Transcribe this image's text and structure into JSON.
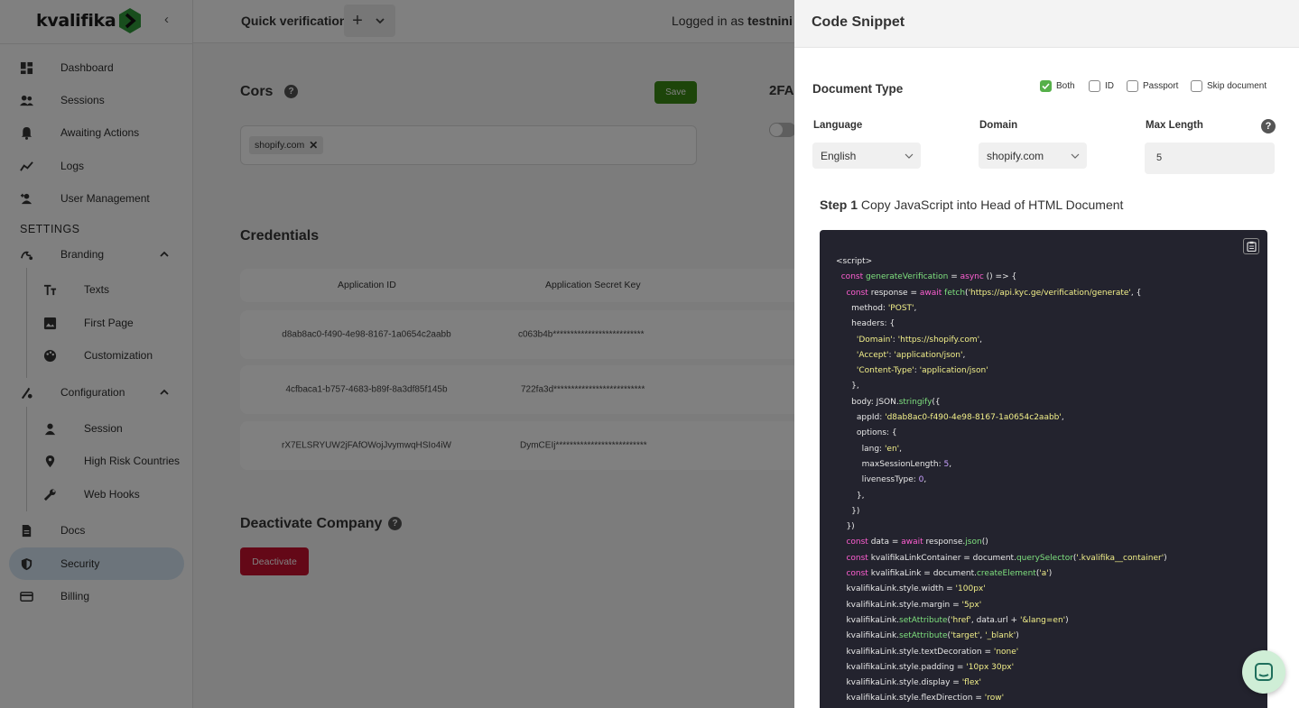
{
  "sidebar": {
    "logo_text": "kvalifika",
    "collapse_icon": "chevron-left-icon",
    "items": [
      {
        "label": "Dashboard",
        "icon": "dashboard-icon"
      },
      {
        "label": "Sessions",
        "icon": "people-icon"
      },
      {
        "label": "Awaiting Actions",
        "icon": "bell-icon"
      },
      {
        "label": "Logs",
        "icon": "trend-line-icon"
      },
      {
        "label": "User Management",
        "icon": "add-user-icon"
      }
    ],
    "settings_heading": "SETTINGS",
    "branding": {
      "label": "Branding",
      "icon": "brush-icon",
      "children": [
        {
          "label": "Texts",
          "icon": "text-size-icon"
        },
        {
          "label": "First Page",
          "icon": "image-icon"
        },
        {
          "label": "Customization",
          "icon": "palette-icon"
        }
      ]
    },
    "configuration": {
      "label": "Configuration",
      "icon": "config-icon",
      "children": [
        {
          "label": "Session",
          "icon": "person-icon"
        },
        {
          "label": "High Risk Countries",
          "icon": "location-pin-icon"
        },
        {
          "label": "Web Hooks",
          "icon": "wrench-icon"
        }
      ]
    },
    "docs": {
      "label": "Docs",
      "icon": "document-icon"
    },
    "security": {
      "label": "Security",
      "icon": "shield-icon"
    },
    "billing": {
      "label": "Billing",
      "icon": "credit-card-icon"
    }
  },
  "topbar": {
    "quick_verification": "Quick verification",
    "plus": "+",
    "logged_in_prefix": "Logged in as",
    "logged_in_user": "testnini"
  },
  "main": {
    "cors_title": "Cors",
    "cors_help": "?",
    "save_label": "Save",
    "cors_chip": "shopify.com",
    "chip_remove": "✕",
    "twofa_title": "2FA",
    "credentials_title": "Credentials",
    "columns": [
      "Application ID",
      "Application Secret Key"
    ],
    "rows": [
      {
        "id": "d8ab8ac0-f490-4e98-8167-1a0654c2aabb",
        "secret": "c063b4b**************************"
      },
      {
        "id": "4cfbaca1-b757-4683-b89f-8a3df85f145b",
        "secret": "722fa3d**************************"
      },
      {
        "id": "rX7ELSRYUW2jFAfOWojJvymwqHSIo4iW",
        "secret": "DymCEIj**************************"
      }
    ],
    "deactivate_title": "Deactivate Company",
    "deactivate_help": "?",
    "deactivate_label": "Deactivate"
  },
  "drawer": {
    "title": "Code Snippet",
    "document_type_label": "Document Type",
    "doc_options": [
      {
        "label": "Both",
        "checked": true
      },
      {
        "label": "ID",
        "checked": false
      },
      {
        "label": "Passport",
        "checked": false
      },
      {
        "label": "Skip document",
        "checked": false
      }
    ],
    "language_label": "Language",
    "language_value": "English",
    "domain_label": "Domain",
    "domain_value": "shopify.com",
    "max_length_label": "Max Length",
    "max_length_value": "5",
    "max_length_help": "?",
    "step_bold": "Step 1",
    "step_text": "Copy JavaScript into Head of HTML Document",
    "copy_icon": "clipboard-icon"
  },
  "colors": {
    "accent_green": "#56b04a",
    "save_green": "#3a8a14",
    "danger_red": "#c8102e",
    "active_nav": "#d7e8f6",
    "code_bg": "#23232e"
  },
  "code_lines": [
    [
      {
        "t": "<script>"
      }
    ],
    [
      {
        "t": "  "
      },
      {
        "t": "const",
        "c": "kw"
      },
      {
        "t": " "
      },
      {
        "t": "generateVerification",
        "c": "fn"
      },
      {
        "t": " = "
      },
      {
        "t": "async",
        "c": "kw"
      },
      {
        "t": " () => {"
      }
    ],
    [
      {
        "t": "    "
      },
      {
        "t": "const",
        "c": "kw"
      },
      {
        "t": " response = "
      },
      {
        "t": "await",
        "c": "kw"
      },
      {
        "t": " "
      },
      {
        "t": "fetch",
        "c": "fn"
      },
      {
        "t": "("
      },
      {
        "t": "'https://api.kyc.ge/verification/generate'",
        "c": "st"
      },
      {
        "t": ", {"
      }
    ],
    [
      {
        "t": "      method: "
      },
      {
        "t": "'POST'",
        "c": "st"
      },
      {
        "t": ","
      }
    ],
    [
      {
        "t": "      headers: {"
      }
    ],
    [
      {
        "t": "        "
      },
      {
        "t": "'Domain'",
        "c": "st"
      },
      {
        "t": ": "
      },
      {
        "t": "'https://shopify.com'",
        "c": "st"
      },
      {
        "t": ","
      }
    ],
    [
      {
        "t": "        "
      },
      {
        "t": "'Accept'",
        "c": "st"
      },
      {
        "t": ": "
      },
      {
        "t": "'application/json'",
        "c": "st"
      },
      {
        "t": ","
      }
    ],
    [
      {
        "t": "        "
      },
      {
        "t": "'Content-Type'",
        "c": "st"
      },
      {
        "t": ": "
      },
      {
        "t": "'application/json'",
        "c": "st"
      }
    ],
    [
      {
        "t": "      },"
      }
    ],
    [
      {
        "t": "      body: JSON."
      },
      {
        "t": "stringify",
        "c": "fn"
      },
      {
        "t": "({"
      }
    ],
    [
      {
        "t": "        appId: "
      },
      {
        "t": "'d8ab8ac0-f490-4e98-8167-1a0654c2aabb'",
        "c": "st"
      },
      {
        "t": ","
      }
    ],
    [
      {
        "t": "        options: {"
      }
    ],
    [
      {
        "t": "          lang: "
      },
      {
        "t": "'en'",
        "c": "st"
      },
      {
        "t": ","
      }
    ],
    [
      {
        "t": "          maxSessionLength: "
      },
      {
        "t": "5",
        "c": "nm"
      },
      {
        "t": ","
      }
    ],
    [
      {
        "t": "          livenessType: "
      },
      {
        "t": "0",
        "c": "nm"
      },
      {
        "t": ","
      }
    ],
    [
      {
        "t": "        },"
      }
    ],
    [
      {
        "t": "      })"
      }
    ],
    [
      {
        "t": "    })"
      }
    ],
    [
      {
        "t": "    "
      },
      {
        "t": "const",
        "c": "kw"
      },
      {
        "t": " data = "
      },
      {
        "t": "await",
        "c": "kw"
      },
      {
        "t": " response."
      },
      {
        "t": "json",
        "c": "fn"
      },
      {
        "t": "()"
      }
    ],
    [
      {
        "t": "    "
      },
      {
        "t": "const",
        "c": "kw"
      },
      {
        "t": " kvalifikaLinkContainer = document."
      },
      {
        "t": "querySelector",
        "c": "fn"
      },
      {
        "t": "("
      },
      {
        "t": "'.kvalifika__container'",
        "c": "st"
      },
      {
        "t": ")"
      }
    ],
    [
      {
        "t": "    "
      },
      {
        "t": "const",
        "c": "kw"
      },
      {
        "t": " kvalifikaLink = document."
      },
      {
        "t": "createElement",
        "c": "fn"
      },
      {
        "t": "("
      },
      {
        "t": "'a'",
        "c": "st"
      },
      {
        "t": ")"
      }
    ],
    [
      {
        "t": "    kvalifikaLink.style.width = "
      },
      {
        "t": "'100px'",
        "c": "st"
      }
    ],
    [
      {
        "t": "    kvalifikaLink.style.margin = "
      },
      {
        "t": "'5px'",
        "c": "st"
      }
    ],
    [
      {
        "t": "    kvalifikaLink."
      },
      {
        "t": "setAttribute",
        "c": "fn"
      },
      {
        "t": "("
      },
      {
        "t": "'href'",
        "c": "st"
      },
      {
        "t": ", data.url + "
      },
      {
        "t": "'&lang=en'",
        "c": "st"
      },
      {
        "t": ")"
      }
    ],
    [
      {
        "t": "    kvalifikaLink."
      },
      {
        "t": "setAttribute",
        "c": "fn"
      },
      {
        "t": "("
      },
      {
        "t": "'target'",
        "c": "st"
      },
      {
        "t": ", "
      },
      {
        "t": "'_blank'",
        "c": "st"
      },
      {
        "t": ")"
      }
    ],
    [
      {
        "t": "    kvalifikaLink.style.textDecoration = "
      },
      {
        "t": "'none'",
        "c": "st"
      }
    ],
    [
      {
        "t": "    kvalifikaLink.style.padding = "
      },
      {
        "t": "'10px 30px'",
        "c": "st"
      }
    ],
    [
      {
        "t": "    kvalifikaLink.style.display = "
      },
      {
        "t": "'flex'",
        "c": "st"
      }
    ],
    [
      {
        "t": "    kvalifikaLink.style.flexDirection = "
      },
      {
        "t": "'row'",
        "c": "st"
      }
    ]
  ]
}
